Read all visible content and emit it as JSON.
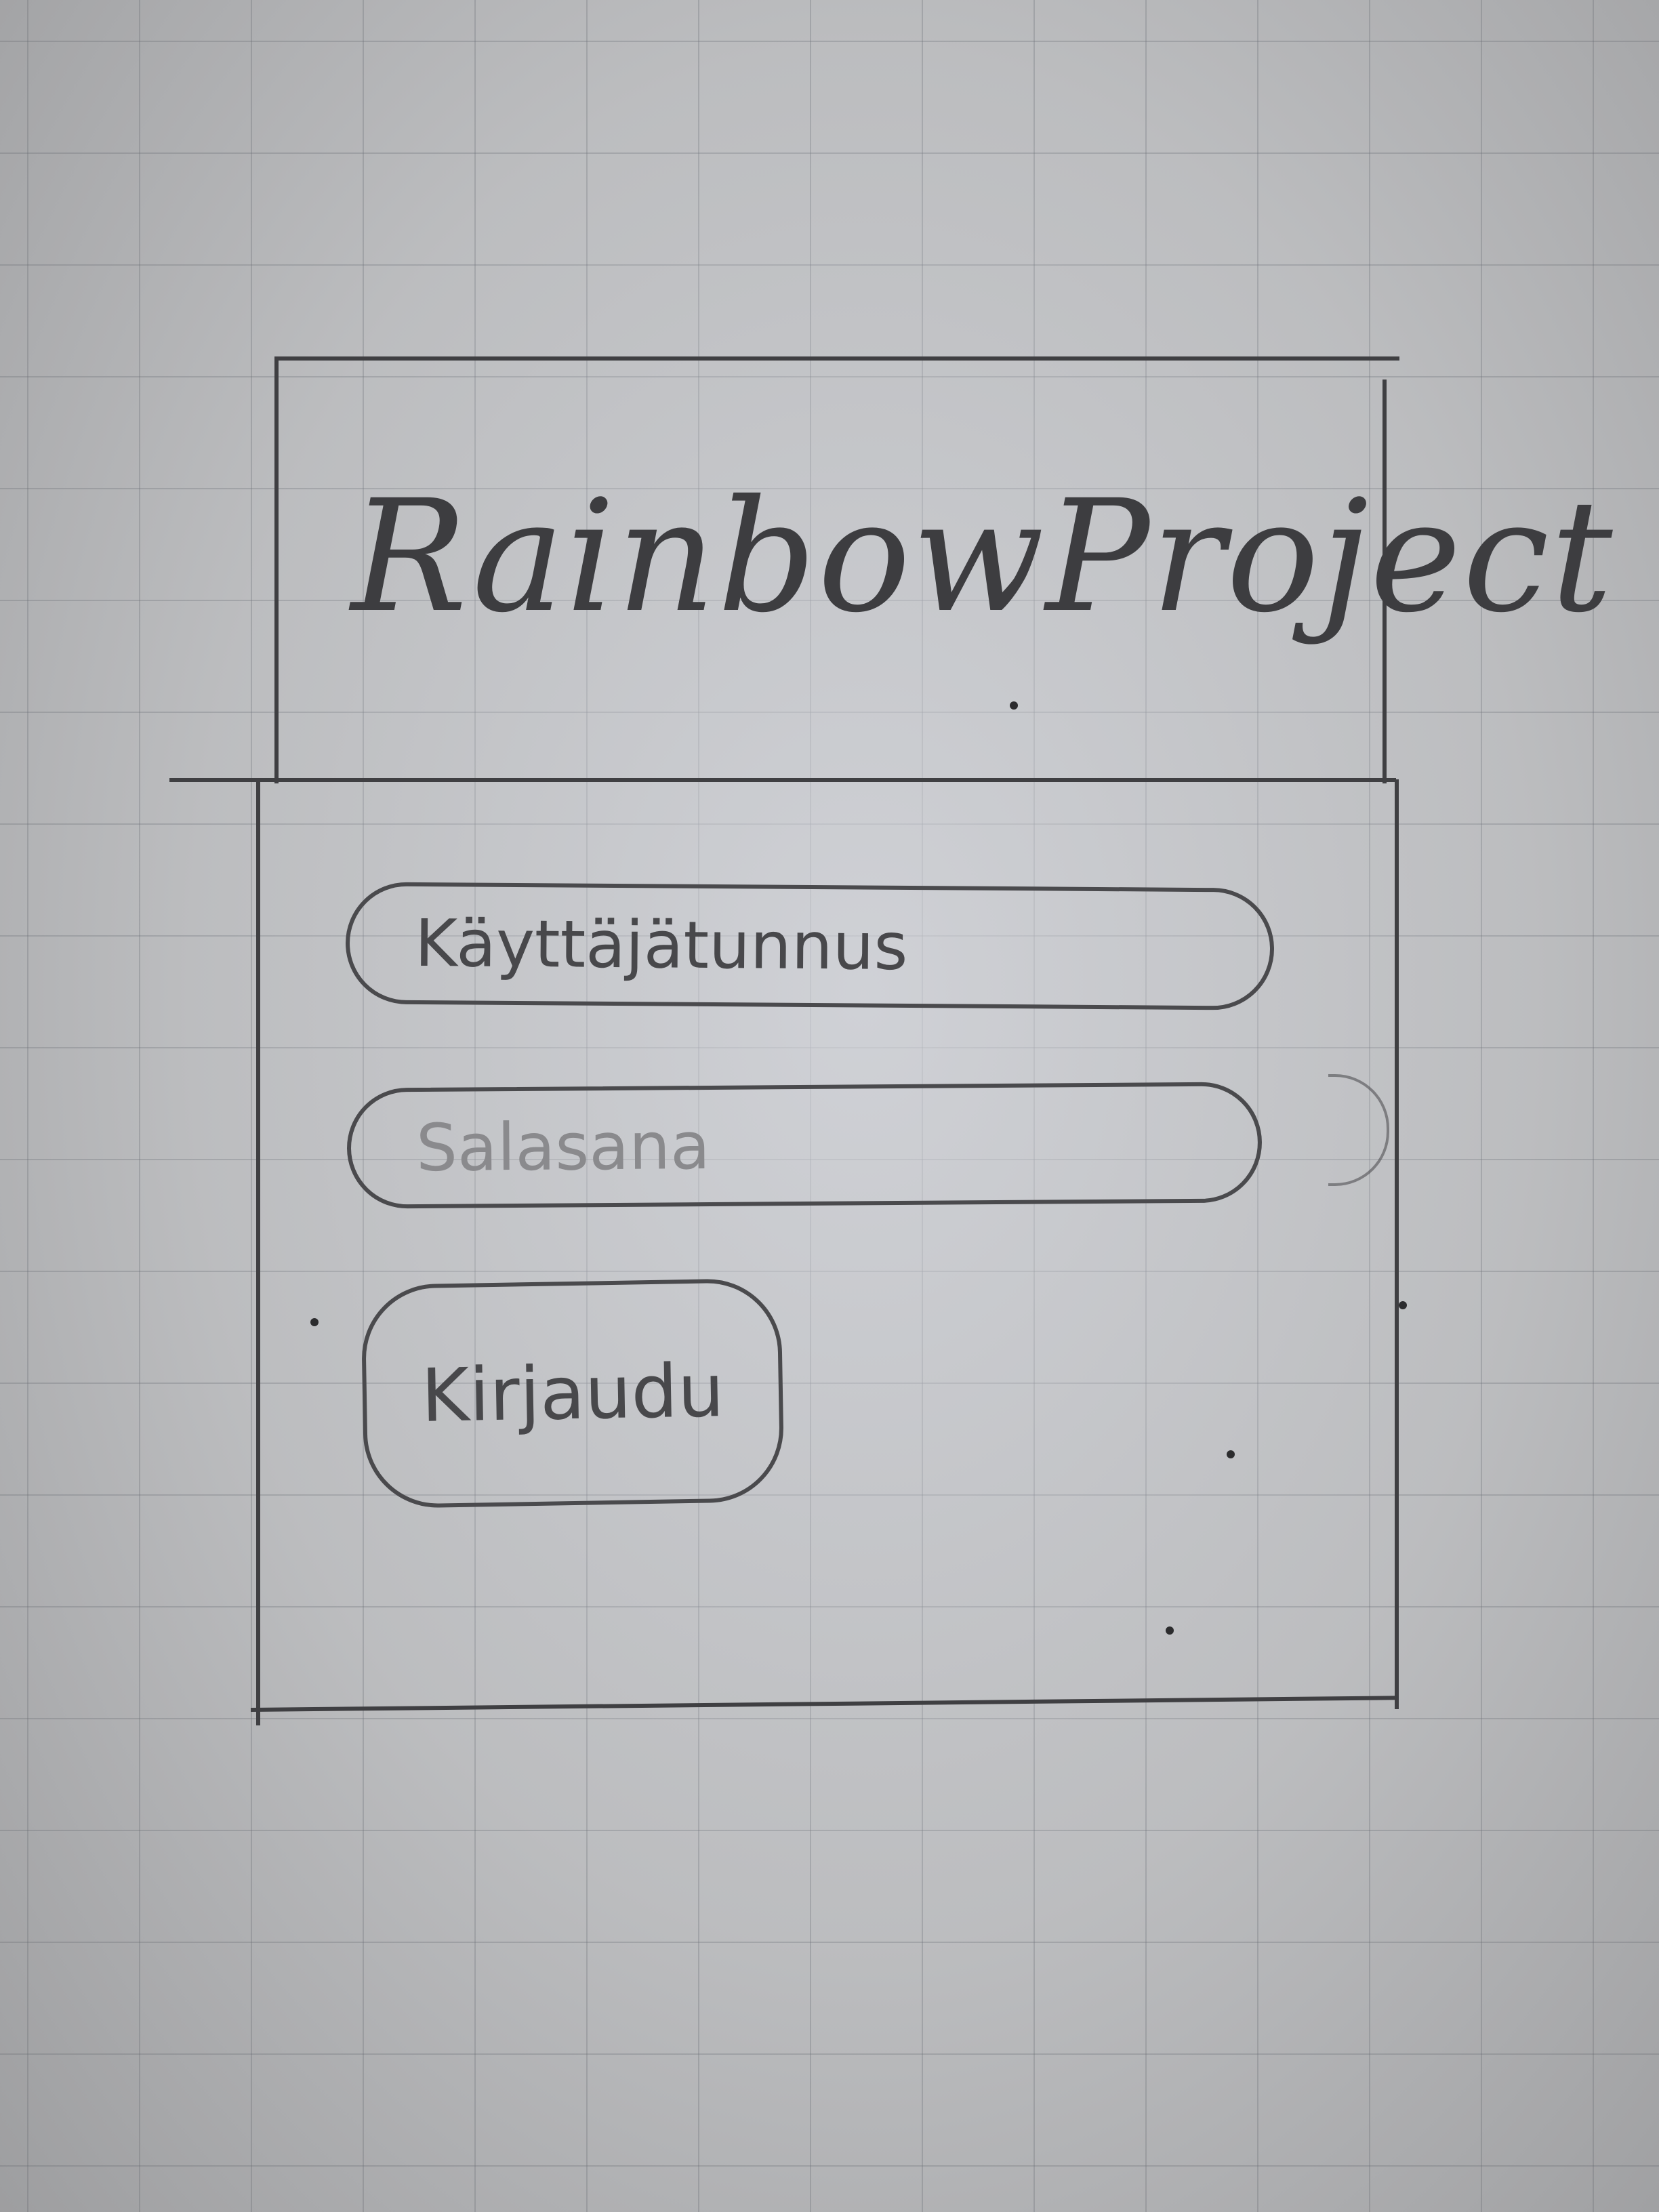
{
  "app": {
    "title": "RainbowProject"
  },
  "login_form": {
    "username_placeholder": "Käyttäjätunnus",
    "password_placeholder": "Salasana",
    "submit_label": "Kirjaudu"
  }
}
